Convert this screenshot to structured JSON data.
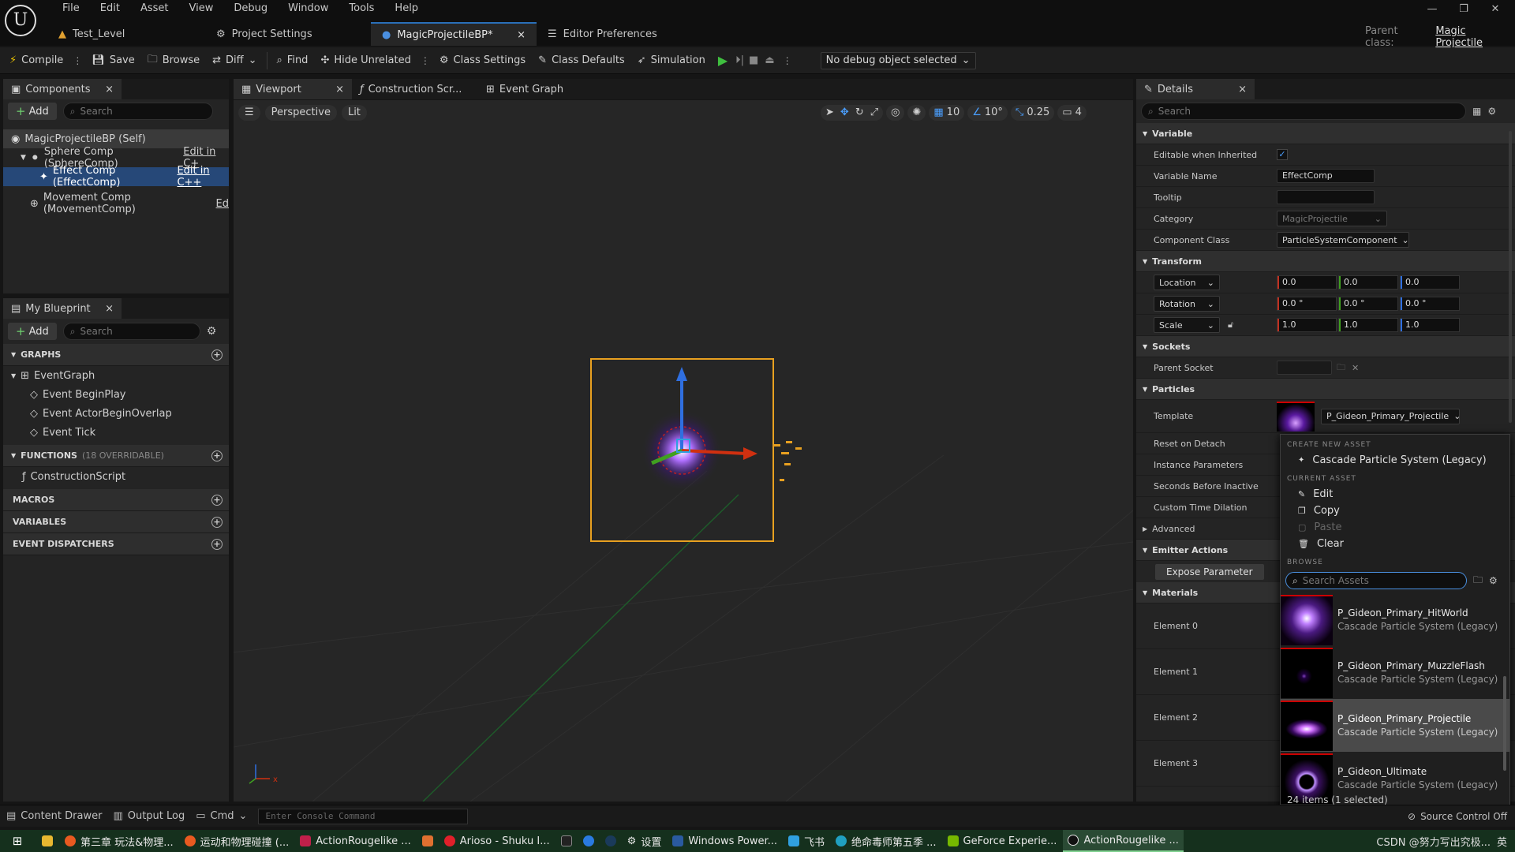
{
  "menu": [
    "File",
    "Edit",
    "Asset",
    "View",
    "Debug",
    "Window",
    "Tools",
    "Help"
  ],
  "doc_tabs": [
    {
      "label": "Test_Level"
    },
    {
      "label": "Project Settings"
    },
    {
      "label": "MagicProjectileBP*"
    },
    {
      "label": "Editor Preferences"
    }
  ],
  "parent_class": {
    "label": "Parent class:",
    "value": "Magic Projectile"
  },
  "toolbar": {
    "compile": "Compile",
    "save": "Save",
    "browse": "Browse",
    "diff": "Diff",
    "find": "Find",
    "hide_unrelated": "Hide Unrelated",
    "class_settings": "Class Settings",
    "class_defaults": "Class Defaults",
    "simulation": "Simulation",
    "debug_object": "No debug object selected"
  },
  "components": {
    "tab": "Components",
    "add": "Add",
    "search_placeholder": "Search",
    "items": [
      {
        "label": "MagicProjectileBP (Self)",
        "edit": ""
      },
      {
        "label": "Sphere Comp (SphereComp)",
        "edit": "Edit in C+"
      },
      {
        "label": "Effect Comp (EffectComp)",
        "edit": "Edit in C++"
      },
      {
        "label": "Movement Comp (MovementComp)",
        "edit": "Ed"
      }
    ]
  },
  "my_blueprint": {
    "tab": "My Blueprint",
    "add": "Add",
    "search_placeholder": "Search",
    "graphs": "GRAPHS",
    "event_graph": "EventGraph",
    "events": [
      "Event BeginPlay",
      "Event ActorBeginOverlap",
      "Event Tick"
    ],
    "functions": "FUNCTIONS",
    "functions_count": "(18 OVERRIDABLE)",
    "construction_script": "ConstructionScript",
    "macros": "MACROS",
    "variables": "VARIABLES",
    "event_dispatchers": "EVENT DISPATCHERS"
  },
  "editor_tabs": [
    "Viewport",
    "Construction Scr...",
    "Event Graph"
  ],
  "viewport": {
    "perspective": "Perspective",
    "lit": "Lit",
    "grid_snap": "10",
    "rot_snap": "10°",
    "scale_snap": "0.25",
    "camera_speed": "4"
  },
  "details": {
    "tab": "Details",
    "search_placeholder": "Search",
    "variable": {
      "header": "Variable",
      "editable_when_inherited": "Editable when Inherited",
      "variable_name_label": "Variable Name",
      "variable_name": "EffectComp",
      "tooltip_label": "Tooltip",
      "category_label": "Category",
      "category": "MagicProjectile",
      "component_class_label": "Component Class",
      "component_class": "ParticleSystemComponent"
    },
    "transform": {
      "header": "Transform",
      "location": "Location",
      "rotation": "Rotation",
      "scale": "Scale",
      "location_values": [
        "0.0",
        "0.0",
        "0.0"
      ],
      "rotation_values": [
        "0.0 °",
        "0.0 °",
        "0.0 °"
      ],
      "scale_values": [
        "1.0",
        "1.0",
        "1.0"
      ]
    },
    "sockets": {
      "header": "Sockets",
      "parent_socket": "Parent Socket"
    },
    "particles": {
      "header": "Particles",
      "template_label": "Template",
      "template_value": "P_Gideon_Primary_Projectile",
      "reset_on_detach": "Reset on Detach",
      "instance_parameters": "Instance Parameters",
      "seconds_before_inactive": "Seconds Before Inactive",
      "custom_time_dilation": "Custom Time Dilation",
      "advanced": "Advanced"
    },
    "emitter_actions": {
      "header": "Emitter Actions",
      "expose": "Expose Parameter"
    },
    "materials": {
      "header": "Materials",
      "elements": [
        "Element 0",
        "Element 1",
        "Element 2",
        "Element 3"
      ]
    }
  },
  "popup": {
    "create_new_asset": "CREATE NEW ASSET",
    "cascade_legacy": "Cascade Particle System (Legacy)",
    "current_asset": "CURRENT ASSET",
    "edit": "Edit",
    "copy": "Copy",
    "paste": "Paste",
    "clear": "Clear",
    "browse": "BROWSE",
    "search_placeholder": "Search Assets",
    "assets": [
      {
        "name": "P_Gideon_Primary_HitWorld",
        "type": "Cascade Particle System (Legacy)",
        "selected": false
      },
      {
        "name": "P_Gideon_Primary_MuzzleFlash",
        "type": "Cascade Particle System (Legacy)",
        "selected": false
      },
      {
        "name": "P_Gideon_Primary_Projectile",
        "type": "Cascade Particle System (Legacy)",
        "selected": true
      },
      {
        "name": "P_Gideon_Ultimate",
        "type": "Cascade Particle System (Legacy)",
        "selected": false
      }
    ],
    "count": "24 items (1 selected)"
  },
  "statusbar": {
    "content_drawer": "Content Drawer",
    "output_log": "Output Log",
    "cmd": "Cmd",
    "console_placeholder": "Enter Console Command",
    "source_control": "Source Control Off"
  },
  "taskbar": {
    "items": [
      "第三章 玩法&物理...",
      "运动和物理碰撞 (...",
      "ActionRougelike ...",
      "",
      "Arioso - Shuku I...",
      "",
      "",
      "",
      "设置",
      "Windows Power...",
      "飞书",
      "绝命毒师第五季 ...",
      "GeForce Experie...",
      "ActionRougelike ..."
    ],
    "tray": "CSDN @努力写出究极...",
    "lang": "英"
  }
}
